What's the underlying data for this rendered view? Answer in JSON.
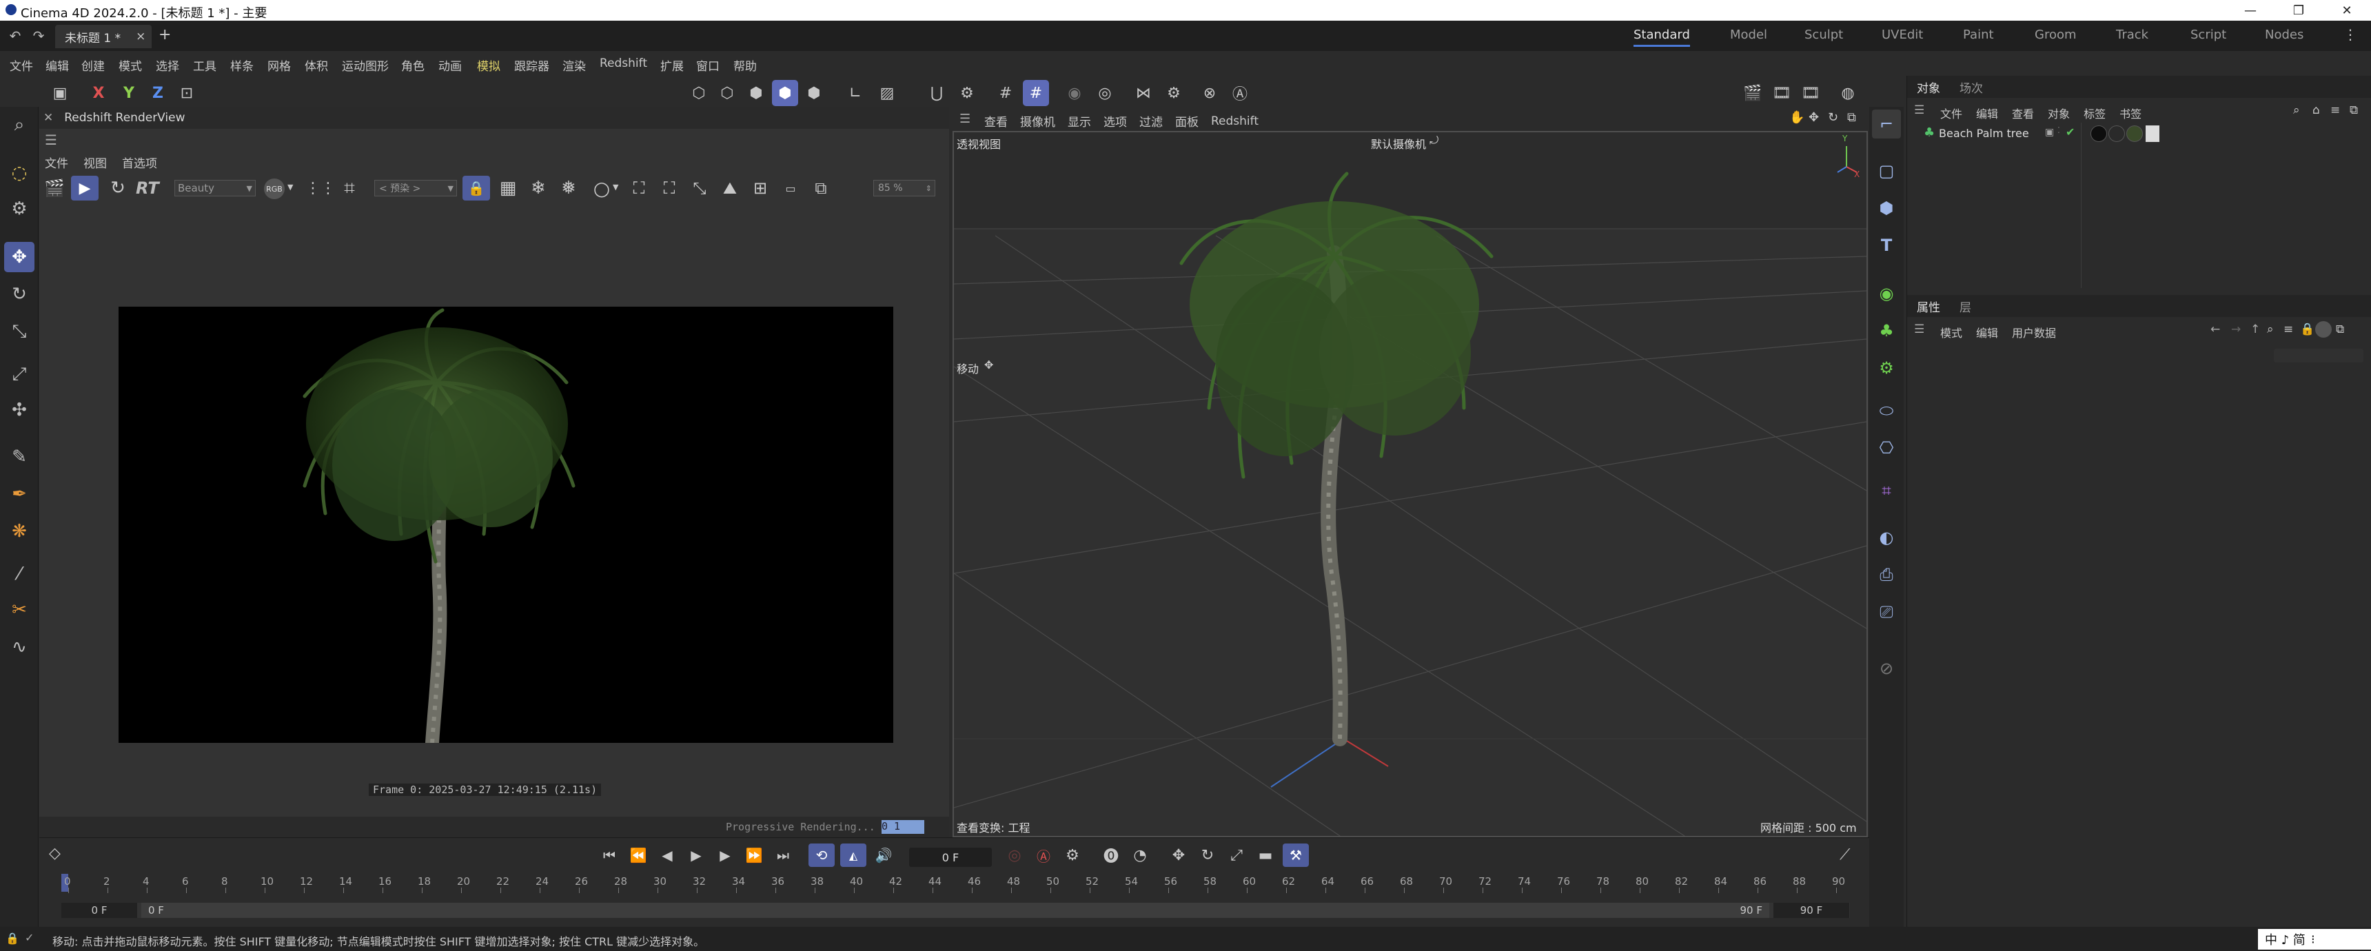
{
  "titlebar": {
    "title": "Cinema 4D 2024.2.0 - [未标题 1 *] - 主要"
  },
  "tabs": {
    "doc_tab": "未标题 1 *",
    "close": "×",
    "add": "+"
  },
  "layouts": [
    "Standard",
    "Model",
    "Sculpt",
    "UVEdit",
    "Paint",
    "Groom",
    "Track",
    "Script",
    "Nodes"
  ],
  "menubar": [
    "文件",
    "编辑",
    "创建",
    "模式",
    "选择",
    "工具",
    "样条",
    "网格",
    "体积",
    "运动图形",
    "角色",
    "动画",
    "模拟",
    "跟踪器",
    "渲染",
    "Redshift",
    "扩展",
    "窗口",
    "帮助"
  ],
  "axes": {
    "x": "X",
    "y": "Y",
    "z": "Z"
  },
  "renderview": {
    "title": "Redshift RenderView",
    "menu": [
      "文件",
      "视图",
      "首选项"
    ],
    "aov": "Beauty",
    "rgb": "RGB",
    "crop": "< 预染 >",
    "rt": "RT",
    "zoom": "85 %",
    "frame_info": "Frame  0:  2025-03-27  12:49:15  (2.11s)",
    "progress_label": "Progressive Rendering...",
    "progress_value": "0 1"
  },
  "viewport": {
    "menu": [
      "查看",
      "摄像机",
      "显示",
      "选项",
      "过滤",
      "面板",
      "Redshift"
    ],
    "name": "透视视图",
    "camera": "默认摄像机",
    "move_label": "移动",
    "view_transform": "查看变换: 工程",
    "grid_spacing": "网格间距 : 500 cm",
    "gizmo": {
      "y": "Y",
      "x": "X"
    }
  },
  "object_manager": {
    "tabs": [
      "对象",
      "场次"
    ],
    "menu": [
      "文件",
      "编辑",
      "查看",
      "对象",
      "标签",
      "书签"
    ],
    "objects": [
      {
        "name": "Beach Palm tree"
      }
    ]
  },
  "attributes": {
    "tabs": [
      "属性",
      "层"
    ],
    "menu": [
      "模式",
      "编辑",
      "用户数据"
    ]
  },
  "timeline": {
    "current_frame": "0 F",
    "start": "0 F",
    "start2": "0 F",
    "end": "90 F",
    "end2": "90 F",
    "ticks": [
      "0",
      "2",
      "4",
      "6",
      "8",
      "10",
      "12",
      "14",
      "16",
      "18",
      "20",
      "22",
      "24",
      "26",
      "28",
      "30",
      "32",
      "34",
      "36",
      "38",
      "40",
      "42",
      "44",
      "46",
      "48",
      "50",
      "52",
      "54",
      "56",
      "58",
      "60",
      "62",
      "64",
      "66",
      "68",
      "70",
      "72",
      "74",
      "76",
      "78",
      "80",
      "82",
      "84",
      "86",
      "88",
      "90"
    ]
  },
  "statusbar": {
    "text": "移动: 点击并拖动鼠标移动元素。按住 SHIFT 键量化移动; 节点编辑模式时按住 SHIFT 键增加选择对象; 按住 CTRL 键减少选择对象。",
    "ime": "中 ♪ 简"
  },
  "colors": {
    "accent": "#4a78d6",
    "active_tool": "#5e6bb8",
    "palm_green": "#3d5a2a",
    "trunk": "#6e6e66"
  }
}
